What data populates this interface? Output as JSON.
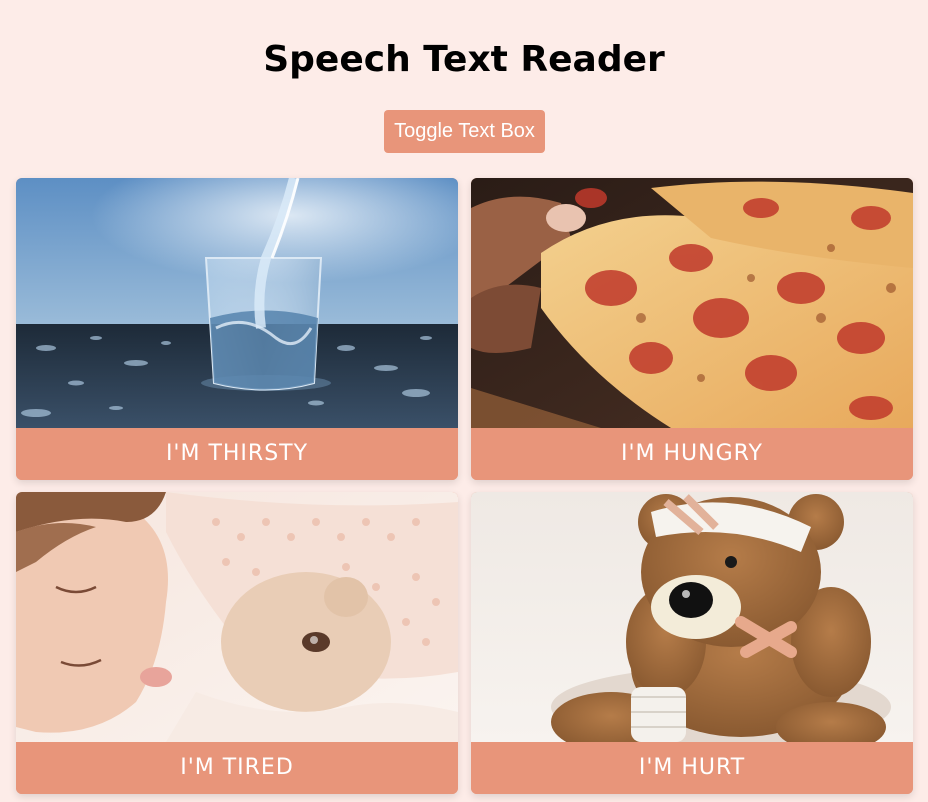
{
  "header": {
    "title": "Speech Text Reader",
    "toggle_label": "Toggle Text Box"
  },
  "cards": [
    {
      "label": "I'M THIRSTY",
      "icon": "water-glass-image"
    },
    {
      "label": "I'M HUNGRY",
      "icon": "pizza-image"
    },
    {
      "label": "I'M TIRED",
      "icon": "sleeping-child-image"
    },
    {
      "label": "I'M HURT",
      "icon": "injured-teddy-bear-image"
    }
  ],
  "colors": {
    "background": "#fdece8",
    "accent": "#e8957a",
    "text": "#000000",
    "label_text": "#ffffff"
  }
}
